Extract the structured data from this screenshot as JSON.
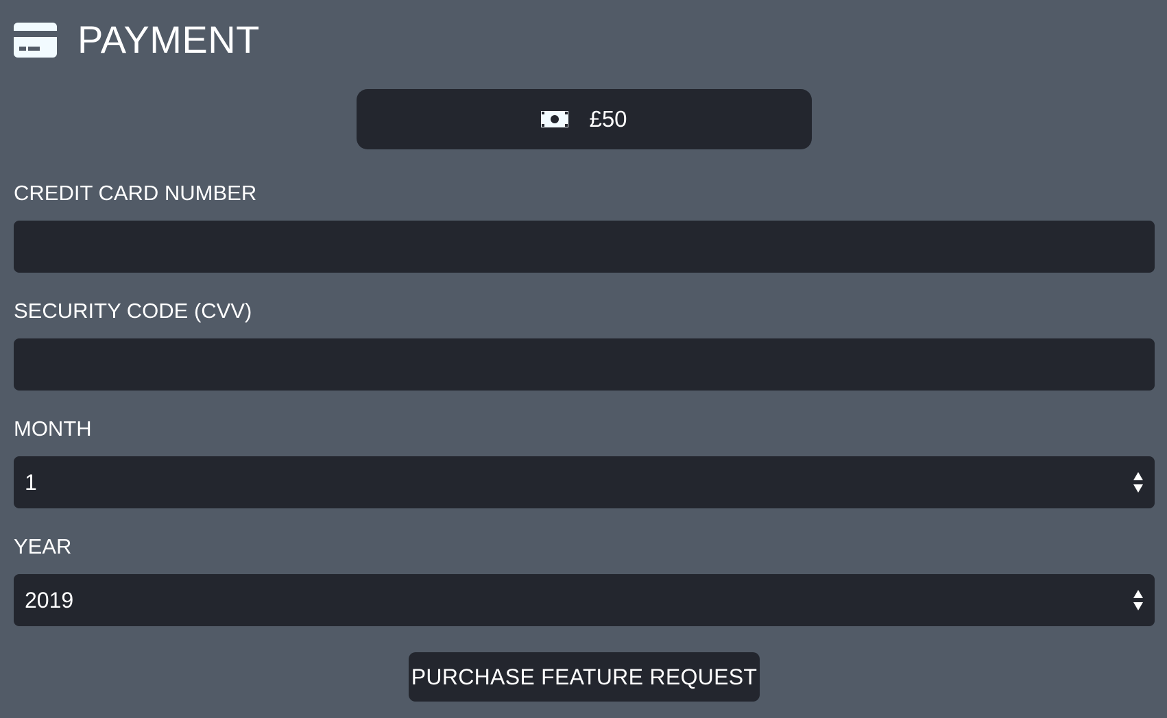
{
  "header": {
    "icon": "credit-card-icon",
    "title": "PAYMENT"
  },
  "amount": {
    "icon": "money-bill-icon",
    "value": "£50"
  },
  "form": {
    "card_number": {
      "label": "CREDIT CARD NUMBER",
      "value": ""
    },
    "cvv": {
      "label": "SECURITY CODE (CVV)",
      "value": ""
    },
    "month": {
      "label": "MONTH",
      "selected": "1"
    },
    "year": {
      "label": "YEAR",
      "selected": "2019"
    }
  },
  "actions": {
    "purchase_label": "PURCHASE FEATURE REQUEST"
  },
  "colors": {
    "background": "#525b67",
    "field_background": "#23262e",
    "text": "#ffffff",
    "icon": "#f2fbff"
  }
}
